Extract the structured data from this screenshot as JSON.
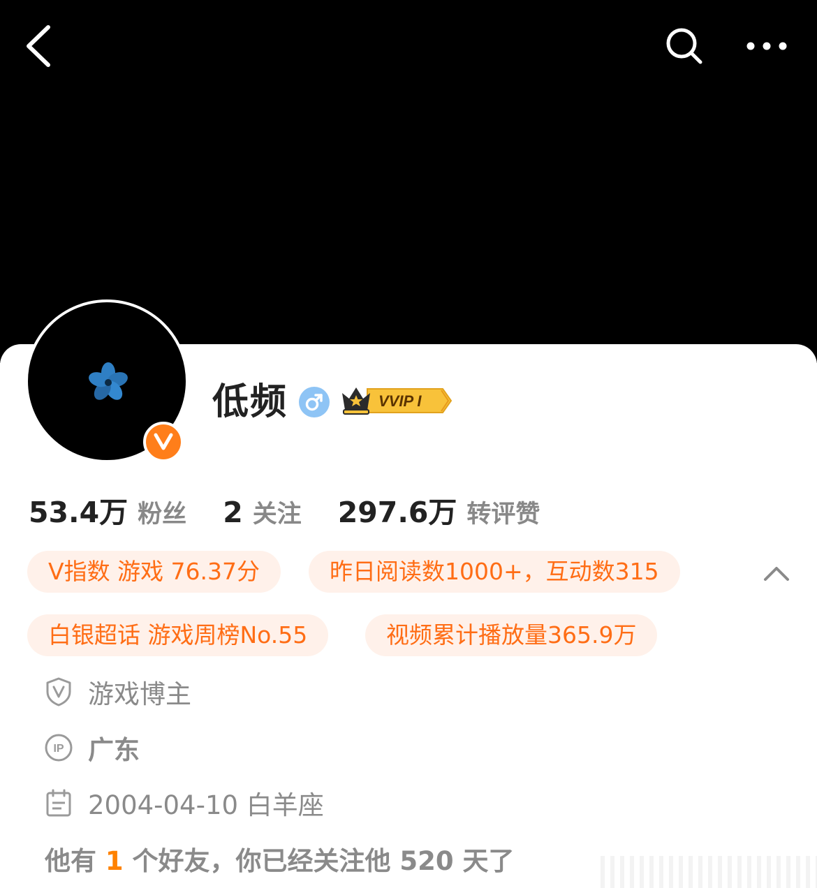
{
  "header": {
    "back_icon": "chevron-left-icon",
    "search_icon": "search-icon",
    "more_icon": "more-horizontal-icon"
  },
  "profile": {
    "username": "低频",
    "gender_symbol": "♂",
    "vip_label": "VVIP I",
    "verified_badge": "V"
  },
  "stats": [
    {
      "value": "53.4万",
      "label": "粉丝"
    },
    {
      "value": "2",
      "label": "关注"
    },
    {
      "value": "297.6万",
      "label": "转评赞"
    }
  ],
  "tags": [
    "V指数 游戏 76.37分",
    "昨日阅读数1000+，互动数315",
    "白银超话 游戏周榜No.55",
    "视频累计播放量365.9万"
  ],
  "info": {
    "role": "游戏博主",
    "ip": "广东",
    "birthday": "2004-04-10 白羊座",
    "ip_icon_text": "IP"
  },
  "friends": {
    "prefix": "他有 ",
    "count": "1",
    "suffix": " 个好友，你已经关注他 520 天了"
  },
  "colors": {
    "accent": "#ff6d15",
    "tag_bg": "#fff1ea",
    "badge": "#ff7e1a",
    "gender": "#8ec4f5"
  }
}
